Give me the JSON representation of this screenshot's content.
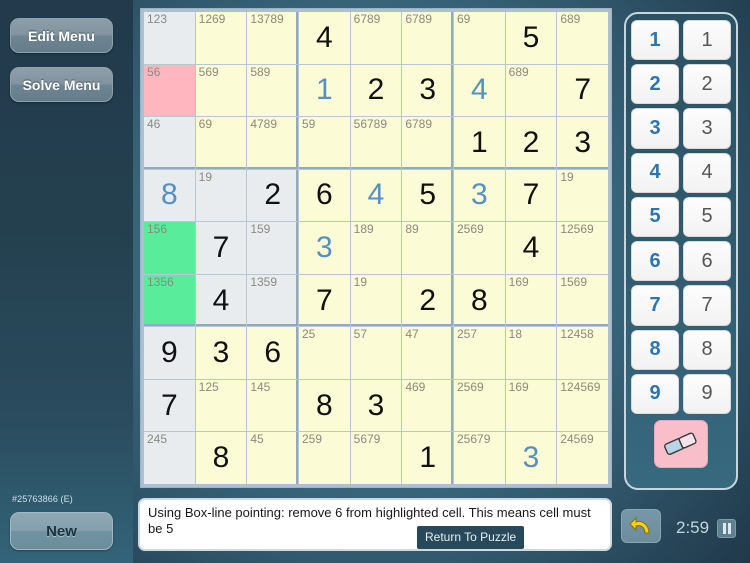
{
  "left_panel": {
    "edit_menu_label": "Edit Menu",
    "solve_menu_label": "Solve Menu",
    "puzzle_id": "#25763866 (E)",
    "new_label": "New"
  },
  "message_bar": {
    "text": "Using Box-line pointing: remove 6 from highlighted cell. This means cell must be 5",
    "return_label": "Return To Puzzle"
  },
  "controls": {
    "undo_icon": "undo-arrow-icon",
    "timer": "2:59",
    "pause_icon": "pause-icon"
  },
  "numberpad": {
    "primary_keys": [
      "1",
      "2",
      "3",
      "4",
      "5",
      "6",
      "7",
      "8",
      "9"
    ],
    "secondary_keys": [
      "1",
      "2",
      "3",
      "4",
      "5",
      "6",
      "7",
      "8",
      "9"
    ],
    "eraser_icon": "eraser-icon",
    "primary_color": "#2f74ad",
    "secondary_color": "#555555"
  },
  "colors": {
    "cell_default": "#fbfbd5",
    "cell_alt": "#e8ecef",
    "cell_highlight_pink": "#ffb6bf",
    "cell_highlight_green": "#58ec9b",
    "given_value": "#111111",
    "user_value": "#5590c4",
    "candidate": "#8a8a80"
  },
  "grid": {
    "rows": [
      [
        {
          "cands": "123",
          "bg": "alt"
        },
        {
          "cands": "1269"
        },
        {
          "cands": "13789"
        },
        {
          "value": "4",
          "style": "given"
        },
        {
          "cands": "6789"
        },
        {
          "cands": "6789"
        },
        {
          "cands": "69"
        },
        {
          "value": "5",
          "style": "given"
        },
        {
          "cands": "689"
        }
      ],
      [
        {
          "cands": "56",
          "bg": "pink"
        },
        {
          "cands": "569"
        },
        {
          "cands": "589"
        },
        {
          "value": "1",
          "style": "user"
        },
        {
          "value": "2",
          "style": "given"
        },
        {
          "value": "3",
          "style": "given"
        },
        {
          "value": "4",
          "style": "user"
        },
        {
          "cands": "689"
        },
        {
          "value": "7",
          "style": "given"
        }
      ],
      [
        {
          "cands": "46",
          "bg": "alt"
        },
        {
          "cands": "69"
        },
        {
          "cands": "4789"
        },
        {
          "cands": "59"
        },
        {
          "cands": "56789"
        },
        {
          "cands": "6789"
        },
        {
          "value": "1",
          "style": "given"
        },
        {
          "value": "2",
          "style": "given"
        },
        {
          "value": "3",
          "style": "given"
        }
      ],
      [
        {
          "value": "8",
          "style": "user",
          "bg": "alt"
        },
        {
          "cands": "19",
          "bg": "alt"
        },
        {
          "value": "2",
          "style": "given",
          "bg": "alt"
        },
        {
          "value": "6",
          "style": "given"
        },
        {
          "value": "4",
          "style": "user"
        },
        {
          "value": "5",
          "style": "given"
        },
        {
          "value": "3",
          "style": "user"
        },
        {
          "value": "7",
          "style": "given"
        },
        {
          "cands": "19"
        }
      ],
      [
        {
          "cands": "156",
          "bg": "green"
        },
        {
          "value": "7",
          "style": "given",
          "bg": "alt"
        },
        {
          "cands": "159",
          "bg": "alt"
        },
        {
          "value": "3",
          "style": "user"
        },
        {
          "cands": "189"
        },
        {
          "cands": "89"
        },
        {
          "cands": "2569"
        },
        {
          "value": "4",
          "style": "given"
        },
        {
          "cands": "12569"
        }
      ],
      [
        {
          "cands": "1356",
          "bg": "green"
        },
        {
          "value": "4",
          "style": "given",
          "bg": "alt"
        },
        {
          "cands": "1359",
          "bg": "alt"
        },
        {
          "value": "7",
          "style": "given"
        },
        {
          "cands": "19"
        },
        {
          "value": "2",
          "style": "given"
        },
        {
          "value": "8",
          "style": "given"
        },
        {
          "cands": "169"
        },
        {
          "cands": "1569"
        }
      ],
      [
        {
          "value": "9",
          "style": "given",
          "bg": "alt"
        },
        {
          "value": "3",
          "style": "given"
        },
        {
          "value": "6",
          "style": "given"
        },
        {
          "cands": "25"
        },
        {
          "cands": "57"
        },
        {
          "cands": "47"
        },
        {
          "cands": "257"
        },
        {
          "cands": "18"
        },
        {
          "cands": "12458"
        }
      ],
      [
        {
          "value": "7",
          "style": "given",
          "bg": "alt"
        },
        {
          "cands": "125"
        },
        {
          "cands": "145"
        },
        {
          "value": "8",
          "style": "given"
        },
        {
          "value": "3",
          "style": "given"
        },
        {
          "cands": "469"
        },
        {
          "cands": "2569"
        },
        {
          "cands": "169"
        },
        {
          "cands": "124569"
        }
      ],
      [
        {
          "cands": "245",
          "bg": "alt"
        },
        {
          "value": "8",
          "style": "given"
        },
        {
          "cands": "45"
        },
        {
          "cands": "259"
        },
        {
          "cands": "5679"
        },
        {
          "value": "1",
          "style": "given"
        },
        {
          "cands": "25679"
        },
        {
          "value": "3",
          "style": "user"
        },
        {
          "cands": "24569"
        }
      ]
    ]
  }
}
